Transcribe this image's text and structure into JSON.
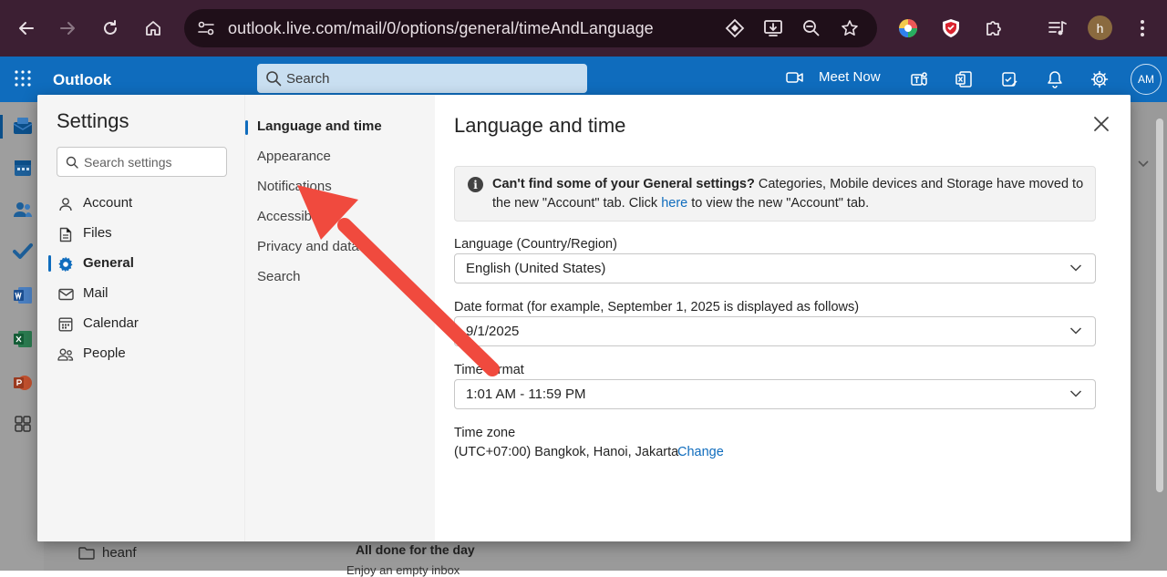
{
  "browser": {
    "url": "outlook.live.com/mail/0/options/general/timeAndLanguage",
    "profile_initial": "h"
  },
  "header": {
    "app_name": "Outlook",
    "search_placeholder": "Search",
    "meet_now": "Meet Now",
    "avatar_initials": "AM"
  },
  "background": {
    "folder": "heanf",
    "all_done": "All done for the day",
    "all_done_sub": "Enjoy an empty inbox"
  },
  "settings": {
    "title": "Settings",
    "search_placeholder": "Search settings",
    "categories": [
      {
        "label": "Account",
        "icon": "person-icon"
      },
      {
        "label": "Files",
        "icon": "document-icon"
      },
      {
        "label": "General",
        "icon": "gear-icon",
        "active": true
      },
      {
        "label": "Mail",
        "icon": "mail-icon"
      },
      {
        "label": "Calendar",
        "icon": "calendar-icon"
      },
      {
        "label": "People",
        "icon": "people-icon"
      }
    ],
    "subcategories": [
      {
        "label": "Language and time",
        "active": true
      },
      {
        "label": "Appearance"
      },
      {
        "label": "Notifications"
      },
      {
        "label": "Accessibility"
      },
      {
        "label": "Privacy and data"
      },
      {
        "label": "Search"
      }
    ],
    "pane": {
      "title": "Language and time",
      "info_bold": "Can't find some of your General settings?",
      "info_text_1": " Categories, Mobile devices and Storage have moved to the new \"Account\" tab. Click ",
      "info_link": "here",
      "info_text_2": " to view the new \"Account\" tab.",
      "language_label": "Language (Country/Region)",
      "language_value": "English (United States)",
      "date_label": "Date format (for example, September 1, 2025 is displayed as follows)",
      "date_value": "9/1/2025",
      "time_label": "Time format",
      "time_value": "1:01 AM - 11:59 PM",
      "tz_label": "Time zone",
      "tz_value": "(UTC+07:00) Bangkok, Hanoi, Jakarta",
      "tz_change": "Change"
    }
  },
  "colors": {
    "outlook_blue": "#0f6cbd",
    "browser_frame": "#3c1f33",
    "annotation_arrow": "#f04a3e"
  }
}
